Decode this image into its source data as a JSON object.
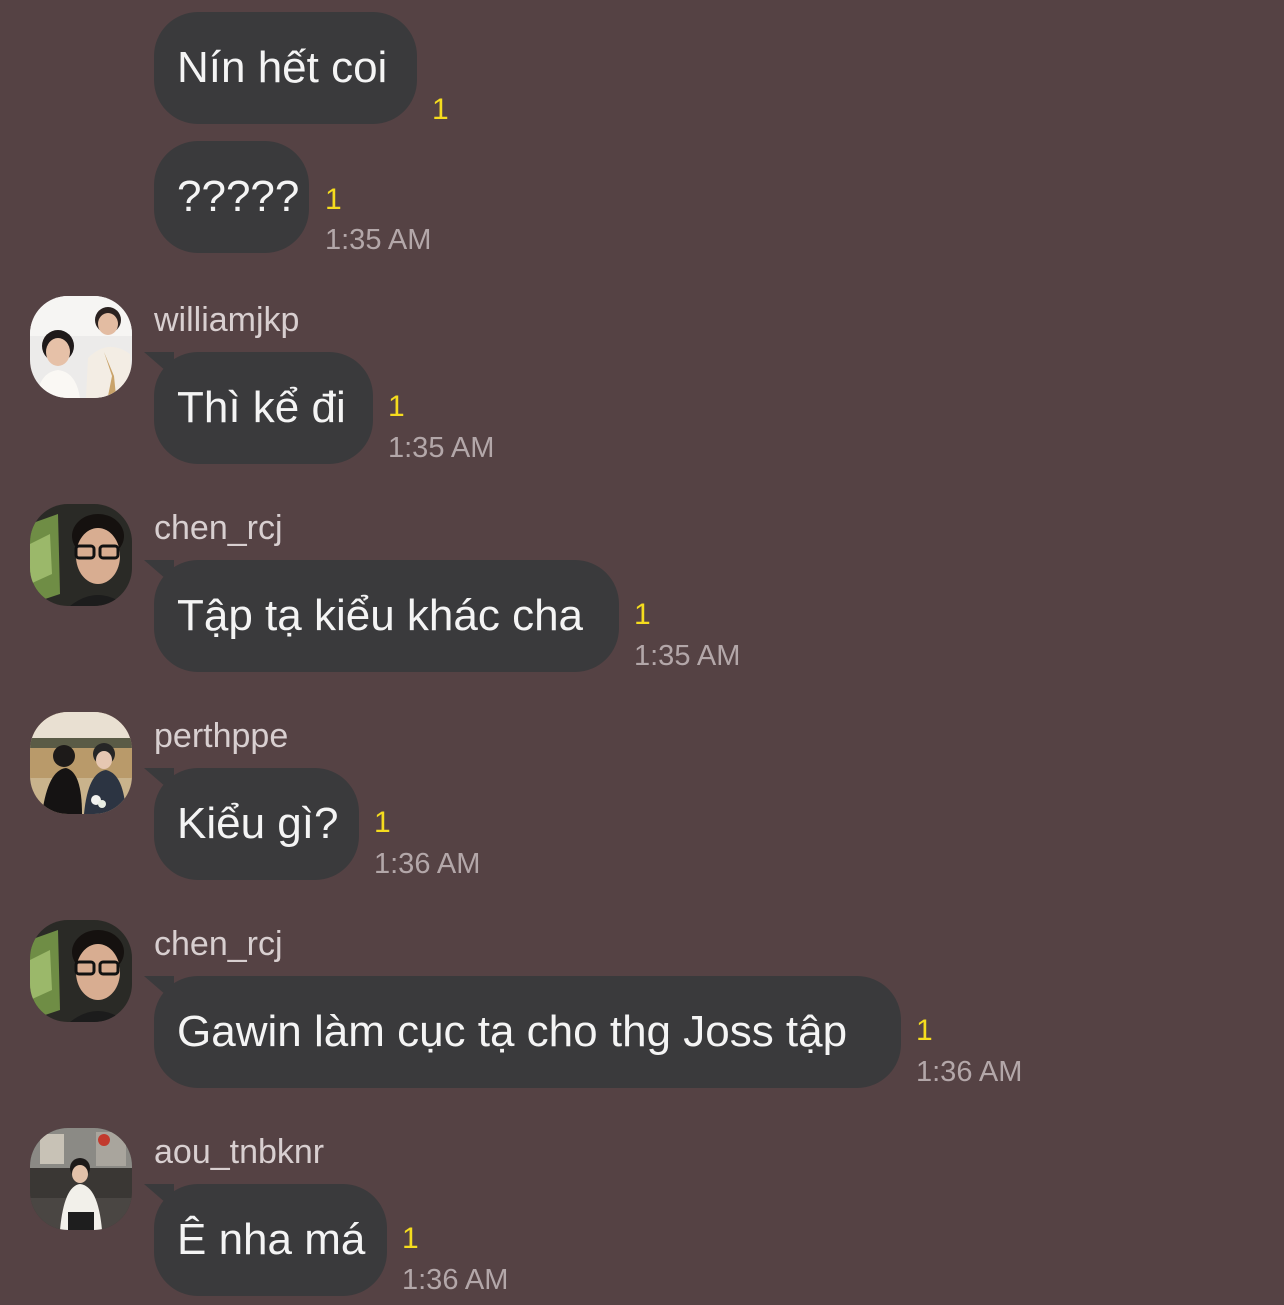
{
  "messages": [
    {
      "text": "Nín hết coi",
      "unread": "1"
    },
    {
      "text": "?????",
      "unread": "1",
      "time": "1:35 AM"
    },
    {
      "user": "williamjkp",
      "avatar": "person-photo-icon",
      "text": "Thì kể đi",
      "unread": "1",
      "time": "1:35 AM"
    },
    {
      "user": "chen_rcj",
      "avatar": "person-photo-icon",
      "text": "Tập tạ kiểu khác cha",
      "unread": "1",
      "time": "1:35 AM"
    },
    {
      "user": "perthppe",
      "avatar": "person-photo-icon",
      "text": "Kiểu gì?",
      "unread": "1",
      "time": "1:36 AM"
    },
    {
      "user": "chen_rcj",
      "avatar": "person-photo-icon",
      "text": "Gawin làm cục tạ cho thg Joss tập",
      "unread": "1",
      "time": "1:36 AM"
    },
    {
      "user": "aou_tnbknr",
      "avatar": "person-photo-icon",
      "text": "Ê nha má",
      "unread": "1",
      "time": "1:36 AM"
    }
  ],
  "colors": {
    "background": "#554244",
    "bubble": "#3a3a3c",
    "bubble_text": "#f4f4f4",
    "unread": "#f5dc1e",
    "timestamp": "#b3a7a9",
    "username": "#d8cfd0"
  }
}
